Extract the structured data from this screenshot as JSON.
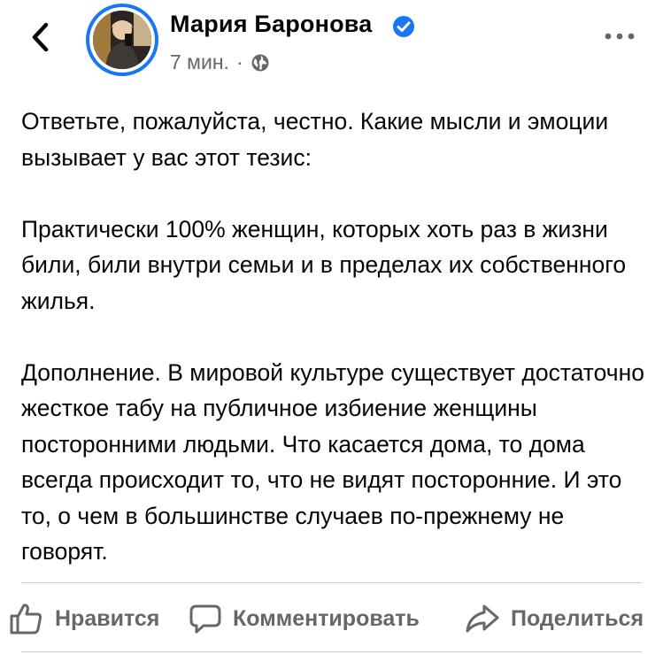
{
  "post": {
    "author": "Мария Баронова",
    "verified_icon": "verified-badge-icon",
    "time": "7 мин.",
    "separator": "·",
    "audience_icon": "globe-icon",
    "paragraphs": [
      "Ответьте, пожалуйста, честно. Какие мысли и эмоции вызывает у вас этот тезис:",
      "Практически 100% женщин, которых хоть раз в жизни били, били внутри семьи и в пределах их собственного жилья.",
      "Дополнение. В мировой культуре существует достаточно жесткое табу на публичное избиение женщины посторонними людьми. Что касается дома, то дома всегда происходит то, что не видят посторонние. И это то, о чем в большинстве случаев по-прежнему не говорят."
    ]
  },
  "actions": {
    "like_label": "Нравится",
    "comment_label": "Комментировать",
    "share_label": "Поделиться"
  },
  "colors": {
    "accent": "#1877f2",
    "secondary_text": "#65676b",
    "divider": "#ced0d4"
  }
}
